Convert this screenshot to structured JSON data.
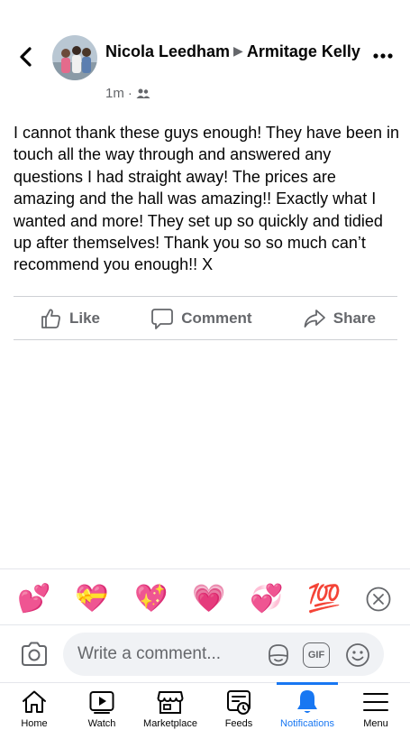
{
  "header": {
    "author": "Nicola Leedham",
    "separator_icon": "triangle-right",
    "target": "Armitage Kelly",
    "time": "1m",
    "audience_icon": "friends-icon"
  },
  "post": {
    "text": "I cannot thank these guys enough! They have been in touch all the way through and answered any questions I had straight away! The prices are amazing and the hall was amazing!! Exactly what I wanted and more! They set up so quickly and tidied up after themselves! Thank you so so much can’t recommend you enough!! X"
  },
  "actions": {
    "like": "Like",
    "comment": "Comment",
    "share": "Share"
  },
  "reactions": [
    "💕",
    "💝",
    "💖",
    "💗",
    "💞",
    "💯"
  ],
  "composer": {
    "placeholder": "Write a comment...",
    "gif_label": "GIF"
  },
  "nav": {
    "items": [
      "Home",
      "Watch",
      "Marketplace",
      "Feeds",
      "Notifications",
      "Menu"
    ],
    "active": "Notifications"
  },
  "colors": {
    "accent": "#1877f2",
    "secondary_text": "#65676b",
    "divider": "#ced0d4"
  }
}
